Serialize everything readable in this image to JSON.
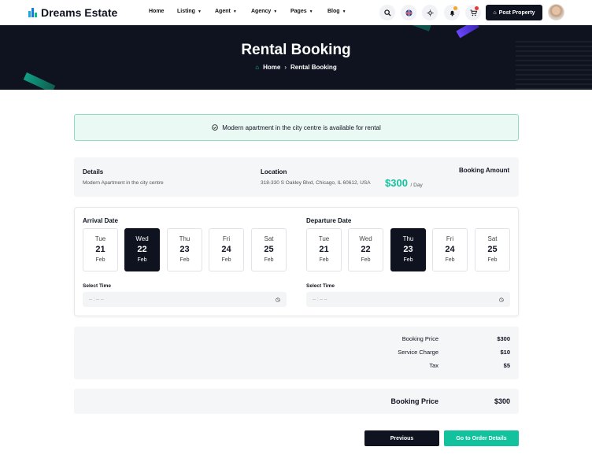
{
  "brand": {
    "name": "Dreams Estate"
  },
  "nav": {
    "items": [
      {
        "label": "Home",
        "has_caret": false
      },
      {
        "label": "Listing",
        "has_caret": true
      },
      {
        "label": "Agent",
        "has_caret": true
      },
      {
        "label": "Agency",
        "has_caret": true
      },
      {
        "label": "Pages",
        "has_caret": true
      },
      {
        "label": "Blog",
        "has_caret": true
      }
    ],
    "post_property_label": "Post Property",
    "icons": [
      "search-icon",
      "language-flag-icon",
      "theme-toggle-icon",
      "bell-icon",
      "cart-icon"
    ],
    "badge_colors": {
      "bell": "#f5a623",
      "cart": "#e53935"
    }
  },
  "hero": {
    "title": "Rental Booking",
    "breadcrumb": {
      "home": "Home",
      "current": "Rental Booking"
    }
  },
  "alert": {
    "text": "Modern apartment in the city centre is available for rental"
  },
  "details": {
    "details_label": "Details",
    "details_value": "Modern Apartment in the city centre",
    "location_label": "Location",
    "location_value": "318-330 S Oakley Blvd, Chicago, IL 60612, USA",
    "amount_label": "Booking Amount",
    "amount_value": "$300",
    "amount_unit": "/ Day"
  },
  "arrival": {
    "label": "Arrival Date",
    "days": [
      {
        "name": "Tue",
        "date": "21",
        "month": "Feb",
        "selected": false
      },
      {
        "name": "Wed",
        "date": "22",
        "month": "Feb",
        "selected": true
      },
      {
        "name": "Thu",
        "date": "23",
        "month": "Feb",
        "selected": false
      },
      {
        "name": "Fri",
        "date": "24",
        "month": "Feb",
        "selected": false
      },
      {
        "name": "Sat",
        "date": "25",
        "month": "Feb",
        "selected": false
      }
    ],
    "time_label": "Select Time",
    "time_placeholder": "-- : -- --"
  },
  "departure": {
    "label": "Departure Date",
    "days": [
      {
        "name": "Tue",
        "date": "21",
        "month": "Feb",
        "selected": false
      },
      {
        "name": "Wed",
        "date": "22",
        "month": "Feb",
        "selected": false
      },
      {
        "name": "Thu",
        "date": "23",
        "month": "Feb",
        "selected": true
      },
      {
        "name": "Fri",
        "date": "24",
        "month": "Feb",
        "selected": false
      },
      {
        "name": "Sat",
        "date": "25",
        "month": "Feb",
        "selected": false
      }
    ],
    "time_label": "Select Time",
    "time_placeholder": "-- : -- --"
  },
  "breakdown": [
    {
      "label": "Booking Price",
      "value": "$300"
    },
    {
      "label": "Service Charge",
      "value": "$10"
    },
    {
      "label": "Tax",
      "value": "$5"
    }
  ],
  "total": {
    "label": "Booking Price",
    "value": "$300"
  },
  "actions": {
    "previous": "Previous",
    "next": "Go to Order Details"
  },
  "colors": {
    "accent": "#12c29d",
    "dark": "#0f1320"
  }
}
